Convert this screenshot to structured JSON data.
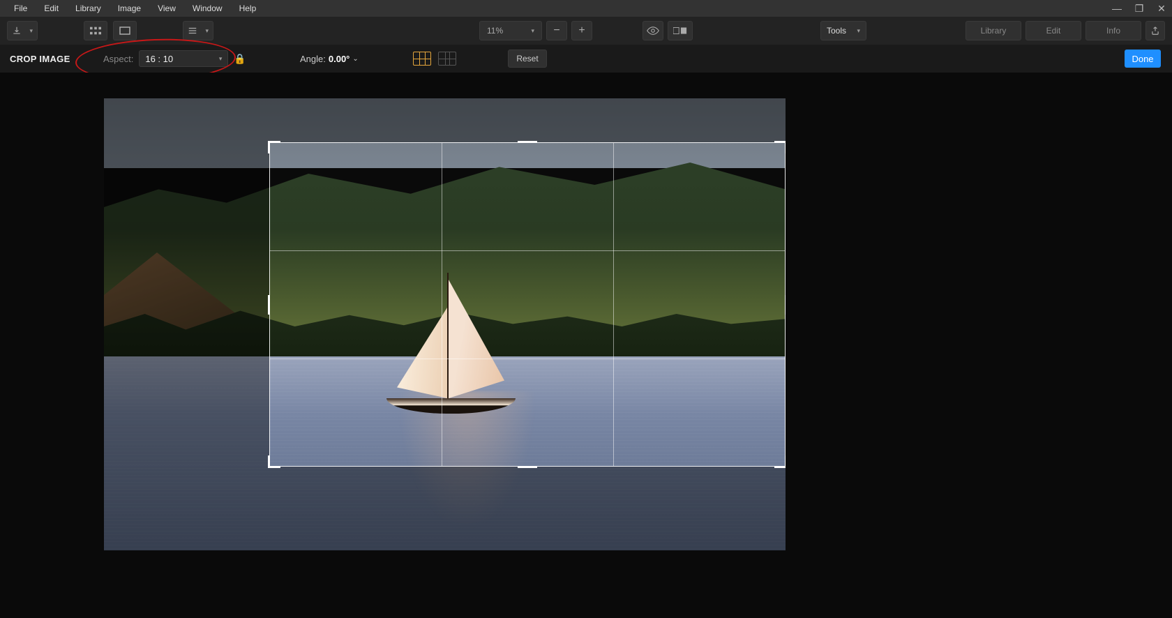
{
  "menubar": {
    "items": [
      "File",
      "Edit",
      "Library",
      "Image",
      "View",
      "Window",
      "Help"
    ]
  },
  "window_controls": {
    "minimize": "—",
    "maximize": "❐",
    "close": "✕"
  },
  "toolbar": {
    "zoom_value": "11%",
    "tools_label": "Tools",
    "panels": {
      "library": "Library",
      "edit": "Edit",
      "info": "Info"
    }
  },
  "cropbar": {
    "title": "CROP IMAGE",
    "aspect_label": "Aspect:",
    "aspect_value": "16 : 10",
    "angle_label": "Angle:",
    "angle_value": "0.00°",
    "reset_label": "Reset",
    "done_label": "Done"
  },
  "icons": {
    "download": "download-icon",
    "grid_thumbs": "thumbnail-grid-icon",
    "single_view": "single-view-icon",
    "list": "list-icon",
    "eye": "eye-icon",
    "compare": "compare-icon",
    "export": "export-icon",
    "lock": "lock-icon"
  }
}
